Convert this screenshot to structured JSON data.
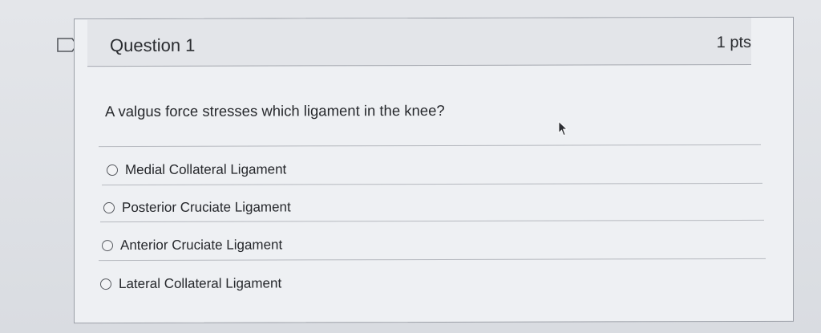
{
  "question": {
    "title": "Question 1",
    "points": "1 pts",
    "text": "A valgus force stresses which ligament in the knee?"
  },
  "answers": [
    {
      "label": "Medial Collateral Ligament"
    },
    {
      "label": "Posterior Cruciate Ligament"
    },
    {
      "label": "Anterior Cruciate Ligament"
    },
    {
      "label": "Lateral Collateral Ligament"
    }
  ],
  "icons": {
    "flag": "flag-question-icon",
    "cursor": "mouse-pointer-icon"
  }
}
